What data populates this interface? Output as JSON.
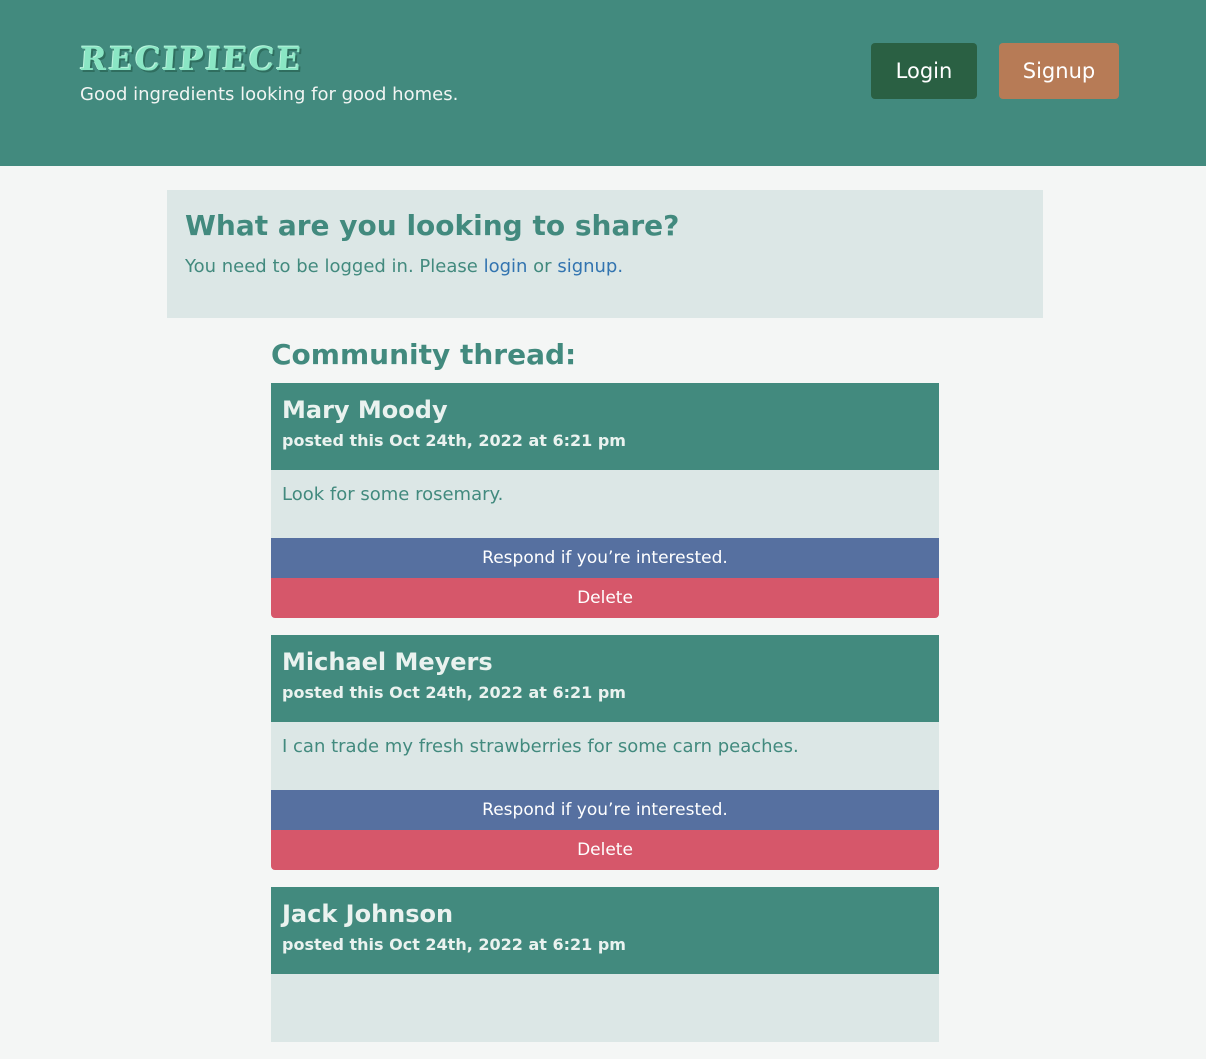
{
  "header": {
    "logo": "RECIPIECE",
    "tagline": "Good ingredients looking for good homes.",
    "login_label": "Login",
    "signup_label": "Signup"
  },
  "share": {
    "title": "What are you looking to share?",
    "message_prefix": "You need to be logged in. Please",
    "login_link": "login",
    "or_text": "or",
    "signup_link": "signup."
  },
  "thread": {
    "title": "Community thread:",
    "posts": [
      {
        "author": "Mary Moody",
        "date": "posted this Oct 24th, 2022 at 6:21 pm",
        "body": "Look for some rosemary.",
        "respond_label": "Respond if you’re interested.",
        "delete_label": "Delete"
      },
      {
        "author": "Michael Meyers",
        "date": "posted this Oct 24th, 2022 at 6:21 pm",
        "body": "I can trade my fresh strawberries for some carn peaches.",
        "respond_label": "Respond if you’re interested.",
        "delete_label": "Delete"
      },
      {
        "author": "Jack Johnson",
        "date": "posted this Oct 24th, 2022 at 6:21 pm",
        "body": "",
        "respond_label": "",
        "delete_label": ""
      }
    ]
  },
  "colors": {
    "primary": "#428a7e",
    "login_button": "#2a6043",
    "signup_button": "#b77b56",
    "respond_button": "#5670a0",
    "delete_button": "#d6576a",
    "panel_bg": "#dce7e6",
    "link": "#3274b0"
  }
}
